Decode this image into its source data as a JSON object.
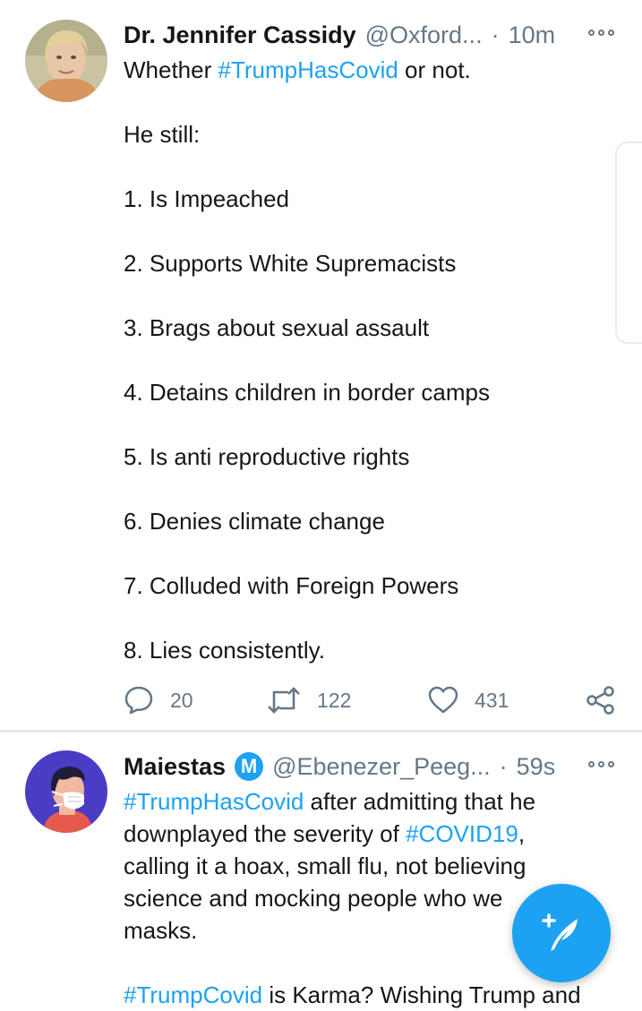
{
  "tweets": [
    {
      "author_name": "Dr. Jennifer Cassidy",
      "handle": "@Oxford...",
      "separator": "·",
      "time": "10m",
      "text_lines": [
        {
          "parts": [
            {
              "text": "Whether ",
              "tag": false
            },
            {
              "text": "#TrumpHasCovid",
              "tag": true
            },
            {
              "text": " or not.",
              "tag": false
            }
          ]
        },
        {
          "gap": true
        },
        {
          "parts": [
            {
              "text": "He still:",
              "tag": false
            }
          ]
        },
        {
          "gap": true
        },
        {
          "parts": [
            {
              "text": "1. Is Impeached",
              "tag": false
            }
          ]
        },
        {
          "gap": true
        },
        {
          "parts": [
            {
              "text": "2. Supports White Supremacists",
              "tag": false
            }
          ]
        },
        {
          "gap": true
        },
        {
          "parts": [
            {
              "text": "3. Brags about sexual assault",
              "tag": false
            }
          ]
        },
        {
          "gap": true
        },
        {
          "parts": [
            {
              "text": "4. Detains children in border camps",
              "tag": false
            }
          ]
        },
        {
          "gap": true
        },
        {
          "parts": [
            {
              "text": "5. Is anti reproductive rights",
              "tag": false
            }
          ]
        },
        {
          "gap": true
        },
        {
          "parts": [
            {
              "text": "6. Denies climate change",
              "tag": false
            }
          ]
        },
        {
          "gap": true
        },
        {
          "parts": [
            {
              "text": "7. Colluded with Foreign Powers",
              "tag": false
            }
          ]
        },
        {
          "gap": true
        },
        {
          "parts": [
            {
              "text": "8. Lies consistently.",
              "tag": false
            }
          ]
        }
      ],
      "actions": {
        "reply_count": "20",
        "retweet_count": "122",
        "like_count": "431"
      }
    },
    {
      "author_name": "Maiestas",
      "badge_letter": "M",
      "handle": "@Ebenezer_Peeg...",
      "separator": "·",
      "time": "59s",
      "text_lines": [
        {
          "parts": [
            {
              "text": "#TrumpHasCovid",
              "tag": true
            },
            {
              "text": " after admitting that he",
              "tag": false
            }
          ]
        },
        {
          "parts": [
            {
              "text": "downplayed the severity of ",
              "tag": false
            },
            {
              "text": "#COVID19",
              "tag": true
            },
            {
              "text": ",",
              "tag": false
            }
          ]
        },
        {
          "parts": [
            {
              "text": "calling it a hoax, small flu, not believing",
              "tag": false
            }
          ]
        },
        {
          "parts": [
            {
              "text": "science and mocking people who we",
              "tag": false
            }
          ]
        },
        {
          "parts": [
            {
              "text": "masks.",
              "tag": false
            }
          ]
        },
        {
          "gap": true
        },
        {
          "parts": [
            {
              "text": "#TrumpCovid",
              "tag": true
            },
            {
              "text": " is Karma? Wishing Trump and",
              "tag": false
            }
          ]
        }
      ]
    }
  ],
  "icons": {
    "reply": "reply-icon",
    "retweet": "retweet-icon",
    "like": "like-icon",
    "share": "share-icon",
    "more": "more-icon",
    "compose": "compose-tweet-icon"
  },
  "colors": {
    "accent": "#1da1f2",
    "text": "#14171a",
    "secondary": "#657786",
    "divider": "#e6ecf0"
  }
}
